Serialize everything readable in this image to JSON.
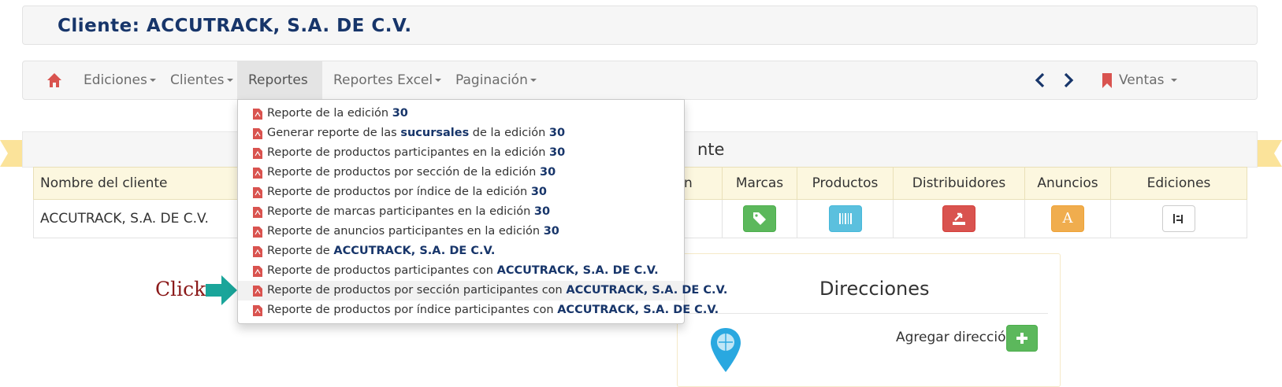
{
  "header": {
    "title": "Cliente: ACCUTRACK, S.A. DE C.V."
  },
  "navbar": {
    "items": [
      {
        "label": "Ediciones"
      },
      {
        "label": "Clientes"
      },
      {
        "label": "Reportes"
      },
      {
        "label": "Reportes Excel"
      },
      {
        "label": "Paginación"
      }
    ],
    "right_menu": "Ventas"
  },
  "panel": {
    "title_fragment": "nte"
  },
  "table": {
    "headers": [
      "Nombre del cliente",
      "n",
      "Marcas",
      "Productos",
      "Distribuidores",
      "Anuncios",
      "Ediciones"
    ],
    "row": {
      "name": "ACCUTRACK, S.A. DE C.V.",
      "anuncios_letter": "A"
    }
  },
  "dropdown": {
    "items": [
      {
        "text": "Reporte de la edición ",
        "bold": "30"
      },
      {
        "text": "Generar reporte de las ",
        "bold": "sucursales",
        "after": " de la edición ",
        "bold2": "30"
      },
      {
        "text": "Reporte de productos participantes en la edición ",
        "bold": "30"
      },
      {
        "text": "Reporte de productos por sección de la edición ",
        "bold": "30"
      },
      {
        "text": "Reporte de productos por índice de la edición ",
        "bold": "30"
      },
      {
        "text": "Reporte de marcas participantes en la edición ",
        "bold": "30"
      },
      {
        "text": "Reporte de anuncios participantes en la edición ",
        "bold": "30"
      },
      {
        "text": "Reporte de ",
        "bold": "ACCUTRACK, S.A. DE C.V."
      },
      {
        "text": "Reporte de productos participantes con ",
        "bold": "ACCUTRACK, S.A. DE C.V."
      },
      {
        "text": "Reporte de productos por sección participantes con ",
        "bold": "ACCUTRACK, S.A. DE C.V."
      },
      {
        "text": "Reporte de productos por índice participantes con ",
        "bold": "ACCUTRACK, S.A. DE C.V."
      }
    ]
  },
  "addresses": {
    "title": "Direcciones",
    "add_label": "Agregar dirección"
  },
  "annotation": {
    "click_label": "Click"
  },
  "colors": {
    "brand_dark": "#17356a",
    "home_red": "#d9534f",
    "green": "#5cb85c",
    "teal_arrow": "#1aa59a"
  }
}
